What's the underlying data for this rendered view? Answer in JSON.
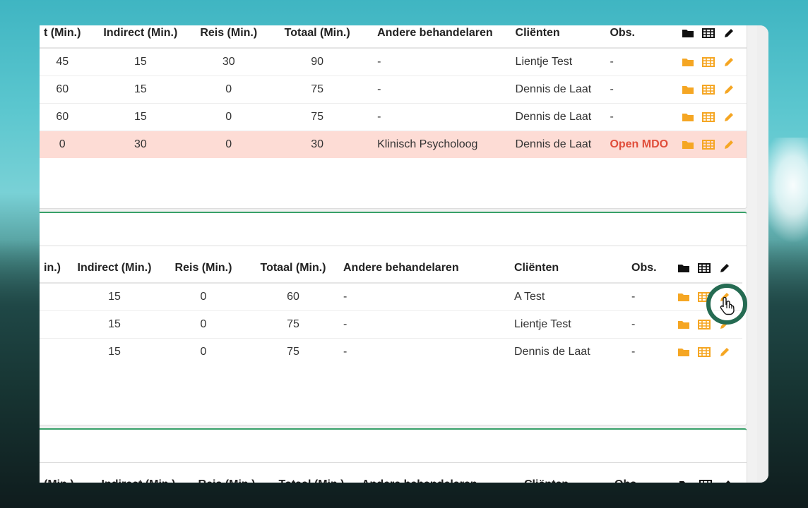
{
  "colors": {
    "accent_green": "#38a169",
    "folder_icon": "#f5a623",
    "table_icon": "#f5a623",
    "edit_icon": "#f5a623",
    "highlight_row": "#fddcd5",
    "open_mdo_text": "#e04d3a"
  },
  "icons": {
    "header": [
      "folder-icon",
      "table-icon",
      "pencil-icon"
    ],
    "row_actions": [
      "folder-icon",
      "table-icon",
      "pencil-icon"
    ]
  },
  "card1": {
    "headers": [
      "t (Min.)",
      "Indirect (Min.)",
      "Reis (Min.)",
      "Totaal (Min.)",
      "Andere behandelaren",
      "Cliënten",
      "Obs."
    ],
    "rows": [
      {
        "direct": "45",
        "indirect": "15",
        "reis": "30",
        "totaal": "90",
        "andere": "-",
        "client": "Lientje Test",
        "obs": "-"
      },
      {
        "direct": "60",
        "indirect": "15",
        "reis": "0",
        "totaal": "75",
        "andere": "-",
        "client": "Dennis de Laat",
        "obs": "-"
      },
      {
        "direct": "60",
        "indirect": "15",
        "reis": "0",
        "totaal": "75",
        "andere": "-",
        "client": "Dennis de Laat",
        "obs": "-"
      },
      {
        "direct": "0",
        "indirect": "30",
        "reis": "0",
        "totaal": "30",
        "andere": "Klinisch Psycholoog",
        "client": "Dennis de Laat",
        "obs": "Open MDO"
      }
    ]
  },
  "card2": {
    "headers": [
      "in.)",
      "Indirect (Min.)",
      "Reis (Min.)",
      "Totaal (Min.)",
      "Andere behandelaren",
      "Cliënten",
      "Obs."
    ],
    "rows": [
      {
        "indirect": "15",
        "reis": "0",
        "totaal": "60",
        "andere": "-",
        "client": "A Test",
        "obs": "-"
      },
      {
        "indirect": "15",
        "reis": "0",
        "totaal": "75",
        "andere": "-",
        "client": "Lientje Test",
        "obs": "-"
      },
      {
        "indirect": "15",
        "reis": "0",
        "totaal": "75",
        "andere": "-",
        "client": "Dennis de Laat",
        "obs": "-"
      }
    ]
  },
  "card3": {
    "headers": [
      "(Min.)",
      "Indirect (Min.)",
      "Reis (Min.)",
      "Totaal (Min.)",
      "Andere behandelaren",
      "Cliënten",
      "Obs."
    ]
  }
}
